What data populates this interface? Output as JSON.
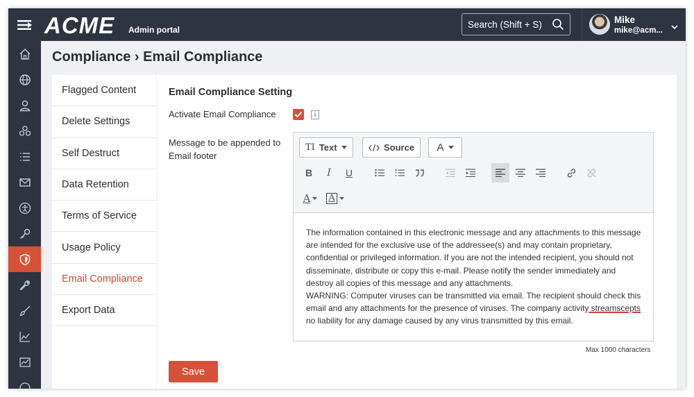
{
  "app": {
    "logo": "ACME",
    "portal": "Admin portal"
  },
  "search": {
    "placeholder": "Search (Shift + S)"
  },
  "user": {
    "name": "Mike",
    "email": "mike@acm..."
  },
  "sidebar": {
    "icons": [
      "home-icon",
      "globe-icon",
      "user-icon",
      "network-icon",
      "list-icon",
      "mail-icon",
      "accessibility-icon",
      "key-icon",
      "shield-icon",
      "wrench-icon",
      "brush-icon",
      "area-chart-icon",
      "trend-chart-icon",
      "help-icon"
    ],
    "active": "shield-icon"
  },
  "breadcrumb": "Compliance › Email Compliance",
  "menu": {
    "items": [
      {
        "label": "Flagged Content"
      },
      {
        "label": "Delete Settings"
      },
      {
        "label": "Self Destruct"
      },
      {
        "label": "Data Retention"
      },
      {
        "label": "Terms of Service"
      },
      {
        "label": "Usage Policy"
      },
      {
        "label": "Email Compliance"
      },
      {
        "label": "Export Data"
      }
    ],
    "active_index": 6
  },
  "main": {
    "section_title": "Email Compliance Setting",
    "activate_label": "Activate Email Compliance",
    "activate_checked": true,
    "info_glyph": "i",
    "footer_label_1": "Message to be appended to",
    "footer_label_2": "Email footer",
    "toolbar": {
      "text_btn": "Text",
      "source_btn": "Source",
      "font_btn": "A"
    },
    "body_part1": "The information contained in this electronic message and any attachments to this message are intended for the exclusive use of the addressee(s) and may contain proprietary, confidential or privileged information. If you are not the intended recipient, you should not disseminate, distribute or copy this e-mail. Please notify the sender immediately and destroy all copies of this message and any attachments.",
    "body_part2": "WARNING: Computer viruses can be transmitted via email. The recipient should check this email and any attachments for the presence of viruses. The company activity",
    "body_misspelled": " streamscepts",
    "body_part3": "no liability for any damage caused by any virus transmitted by this email.",
    "max_chars": "Max 1000 characters",
    "save_label": "Save"
  },
  "colors": {
    "accent": "#d55138",
    "topbar": "#2e3440"
  }
}
